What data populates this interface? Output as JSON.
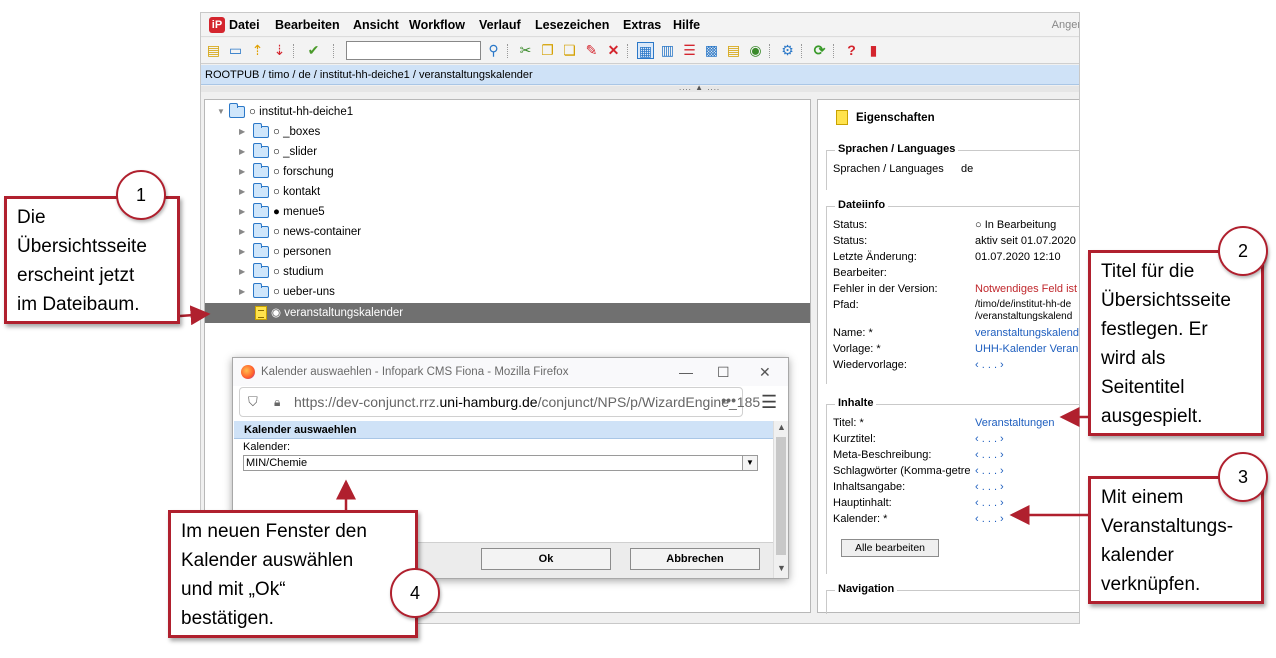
{
  "menubar": {
    "items": [
      "Datei",
      "Bearbeiten",
      "Ansicht",
      "Workflow",
      "Verlauf",
      "Lesezeichen",
      "Extras",
      "Hilfe"
    ],
    "user": "Anger"
  },
  "breadcrumb": "ROOTPUB / timo / de / institut-hh-deiche1 / veranstaltungskalender",
  "tree": {
    "root": "○ institut-hh-deiche1",
    "items": [
      "○ _boxes",
      "○ _slider",
      "○ forschung",
      "○ kontakt",
      "● menue5",
      "○ news-container",
      "○ personen",
      "○ studium",
      "○ ueber-uns"
    ],
    "selected": "◉ veranstaltungskalender"
  },
  "properties": {
    "title": "Eigenschaften",
    "languages": {
      "heading": "Sprachen / Languages",
      "key": "Sprachen / Languages",
      "value": "de"
    },
    "fileinfo": {
      "heading": "Dateiinfo",
      "rows": [
        {
          "k": "Status:",
          "v": "○ In Bearbeitung"
        },
        {
          "k": "Status:",
          "v": "aktiv seit 01.07.2020"
        },
        {
          "k": "Letzte Änderung:",
          "v": "01.07.2020 12:10"
        },
        {
          "k": "Bearbeiter:",
          "v": ""
        },
        {
          "k": "Fehler in der Version:",
          "v": "Notwendiges Feld ist"
        },
        {
          "k": "Pfad:",
          "v": "/timo/de/institut-hh-de"
        },
        {
          "k": "",
          "v": "/veranstaltungskalend"
        },
        {
          "k": "Name: *",
          "v": "veranstaltungskalend"
        },
        {
          "k": "Vorlage: *",
          "v": "UHH-Kalender Veran"
        },
        {
          "k": "Wiedervorlage:",
          "v": "‹ . . . ›"
        }
      ]
    },
    "content": {
      "heading": "Inhalte",
      "rows": [
        {
          "k": "Titel: *",
          "v": "Veranstaltungen"
        },
        {
          "k": "Kurztitel:",
          "v": "‹ . . . ›"
        },
        {
          "k": "Meta-Beschreibung:",
          "v": "‹ . . . ›"
        },
        {
          "k": "Schlagwörter (Komma-getre",
          "v": "‹ . . . ›"
        },
        {
          "k": "Inhaltsangabe:",
          "v": "‹ . . . ›"
        },
        {
          "k": "Hauptinhalt:",
          "v": "‹ . . . ›"
        },
        {
          "k": "Kalender: *",
          "v": "‹ . . . ›"
        }
      ],
      "edit_all": "Alle bearbeiten"
    },
    "navigation": {
      "heading": "Navigation"
    }
  },
  "dialog": {
    "window_title": "Kalender auswaehlen - Infopark CMS Fiona - Mozilla Firefox",
    "url_prefix": "https://dev-conjunct.rrz.",
    "url_domain": "uni-hamburg.de",
    "url_suffix": "/conjunct/NPS/p/WizardEngine_185",
    "url_more": "•••",
    "header": "Kalender auswaehlen",
    "calendar_label": "Kalender:",
    "calendar_value": "MIN/Chemie",
    "ok": "Ok",
    "cancel": "Abbrechen"
  },
  "callouts": {
    "c1": {
      "num": "1",
      "lines": [
        "Die",
        "Übersichtsseite",
        "erscheint jetzt",
        "im Dateibaum."
      ]
    },
    "c2": {
      "num": "2",
      "lines": [
        "Titel für die",
        "Übersichtsseite",
        "festlegen. Er",
        "wird als",
        "Seitentitel",
        "ausgespielt."
      ]
    },
    "c3": {
      "num": "3",
      "lines": [
        "Mit einem",
        "Veranstaltungs-",
        "kalender",
        "verknüpfen."
      ]
    },
    "c4": {
      "num": "4",
      "lines": [
        "Im neuen Fenster den",
        "Kalender auswählen",
        "und mit „Ok“",
        "bestätigen."
      ]
    }
  },
  "colors": {
    "accent_red": "#b0202e",
    "selection": "#707070",
    "breadcrumb_bg": "#cfe2f7",
    "link": "#1f5fbf"
  }
}
